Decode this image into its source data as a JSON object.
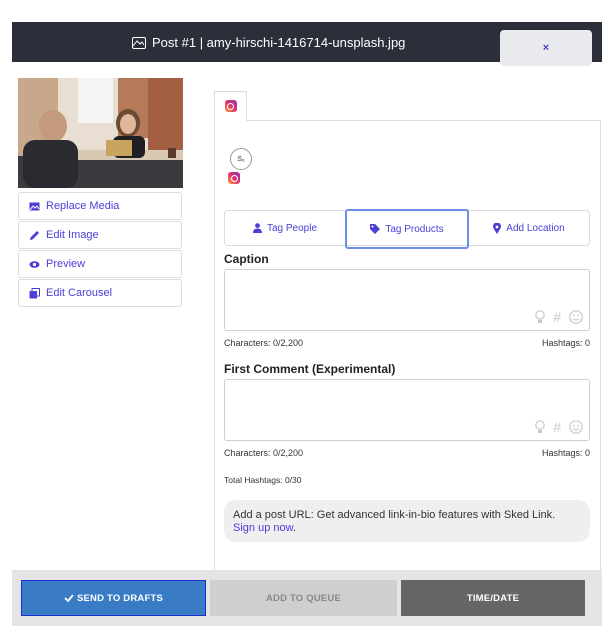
{
  "header": {
    "title": "Post #1 | amy-hirschi-1416714-unsplash.jpg",
    "close_label": "×"
  },
  "media_menu": [
    {
      "label": "Replace Media",
      "icon": "image-icon"
    },
    {
      "label": "Edit Image",
      "icon": "pencil-icon"
    },
    {
      "label": "Preview",
      "icon": "eye-icon"
    },
    {
      "label": "Edit Carousel",
      "icon": "carousel-icon"
    }
  ],
  "account": {
    "avatar_text": "S₆"
  },
  "tag_buttons": [
    {
      "label": "Tag People",
      "icon": "user-icon"
    },
    {
      "label": "Tag Products",
      "icon": "tag-icon"
    },
    {
      "label": "Add Location",
      "icon": "map-pin-icon"
    }
  ],
  "caption": {
    "label": "Caption",
    "characters": "Characters: 0/2,200",
    "hashtags": "Hashtags: 0"
  },
  "first_comment": {
    "label": "First Comment (Experimental)",
    "characters": "Characters: 0/2,200",
    "hashtags": "Hashtags: 0"
  },
  "total_hashtags": "Total Hashtags: 0/30",
  "hint": {
    "text": "Add a post URL: Get advanced link-in-bio features with Sked Link.",
    "link": "Sign up now",
    "suffix": "."
  },
  "footer": {
    "drafts": "SEND TO DRAFTS",
    "queue": "ADD TO QUEUE",
    "time": "TIME/DATE"
  },
  "colors": {
    "accent": "#4b3fd6",
    "header_bg": "#2c2f3a",
    "primary_button": "#3a7bc6",
    "dark_button": "#666666"
  }
}
